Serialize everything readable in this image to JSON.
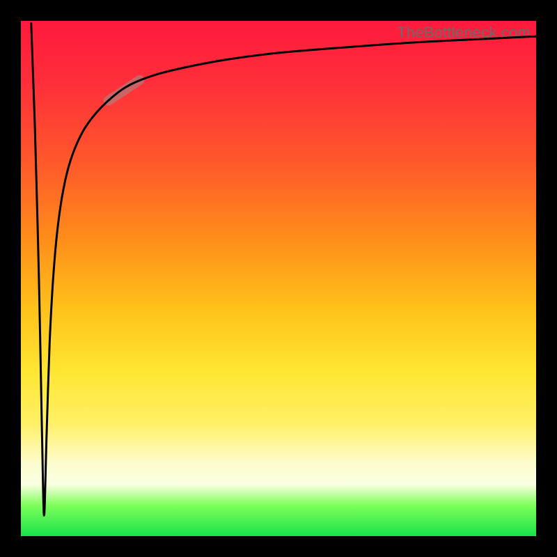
{
  "attribution": "TheBottleneck.com",
  "colors": {
    "frame": "#000000",
    "gradient_stops": [
      "#ff1a3d",
      "#ff2e3a",
      "#ff5a2a",
      "#ff8c1a",
      "#ffc21a",
      "#ffe633",
      "#fff066",
      "#fdfccf",
      "#f9ffe0",
      "#7dff5a",
      "#18e24a"
    ],
    "curve": "#000000",
    "highlight": "rgba(182,120,120,0.72)"
  },
  "chart_data": {
    "type": "line",
    "title": "",
    "xlabel": "",
    "ylabel": "",
    "x_range_pct": [
      0,
      100
    ],
    "y_range_pct": [
      0,
      100
    ],
    "note": "Axes are unlabeled; values below are percentage coordinates of the visible plot area (0,0 = bottom-left, 100,100 = top-right). Curve plunges from top-left to a narrow minimum near x≈4.5%, then rises steeply and asymptotes toward y≈97% at the right edge.",
    "series": [
      {
        "name": "bottleneck-curve",
        "x": [
          2.0,
          2.7,
          3.5,
          4.1,
          4.5,
          5.0,
          5.6,
          6.4,
          7.4,
          8.6,
          10.0,
          12.0,
          14.5,
          17.5,
          21.0,
          26.0,
          32.0,
          40.0,
          50.0,
          62.0,
          76.0,
          90.0,
          100.0
        ],
        "y": [
          99.5,
          80.0,
          50.0,
          20.0,
          4.0,
          20.0,
          38.0,
          52.0,
          62.0,
          69.0,
          74.0,
          78.5,
          82.0,
          85.0,
          87.5,
          89.5,
          91.0,
          92.5,
          93.8,
          94.8,
          95.8,
          96.5,
          97.0
        ]
      }
    ],
    "highlight_segment": {
      "description": "short thick muted-red overlay segment on the rising curve",
      "x_pct": [
        17.0,
        23.0
      ],
      "y_pct": [
        84.5,
        88.5
      ]
    }
  }
}
